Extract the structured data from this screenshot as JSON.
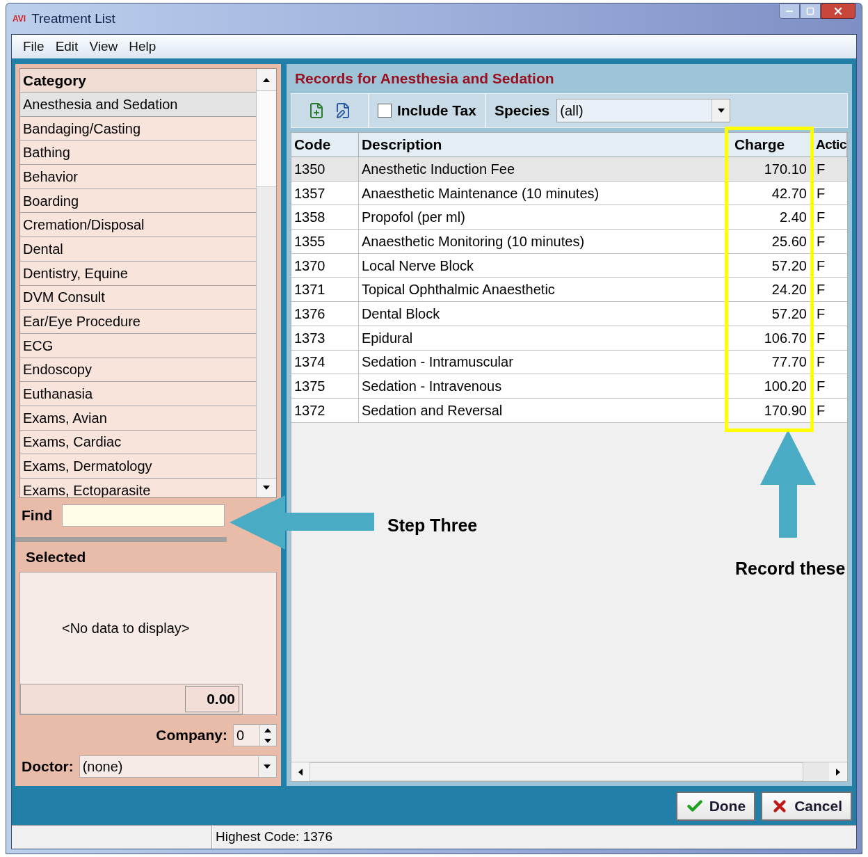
{
  "window": {
    "logo": "AVI",
    "title": "Treatment List"
  },
  "menu": [
    "File",
    "Edit",
    "View",
    "Help"
  ],
  "category_list": {
    "header": "Category",
    "items": [
      {
        "label": "Anesthesia and Sedation",
        "selected": true
      },
      {
        "label": "Bandaging/Casting",
        "selected": false
      },
      {
        "label": "Bathing",
        "selected": false
      },
      {
        "label": "Behavior",
        "selected": false
      },
      {
        "label": "Boarding",
        "selected": false
      },
      {
        "label": "Cremation/Disposal",
        "selected": false
      },
      {
        "label": "Dental",
        "selected": false
      },
      {
        "label": "Dentistry, Equine",
        "selected": false
      },
      {
        "label": "DVM Consult",
        "selected": false
      },
      {
        "label": "Ear/Eye Procedure",
        "selected": false
      },
      {
        "label": "ECG",
        "selected": false
      },
      {
        "label": "Endoscopy",
        "selected": false
      },
      {
        "label": "Euthanasia",
        "selected": false
      },
      {
        "label": "Exams, Avian",
        "selected": false
      },
      {
        "label": "Exams, Cardiac",
        "selected": false
      },
      {
        "label": "Exams, Dermatology",
        "selected": false
      },
      {
        "label": "Exams, Ectoparasite",
        "selected": false
      }
    ]
  },
  "find": {
    "label": "Find"
  },
  "selected_panel": {
    "title": "Selected",
    "empty_message": "<No data to display>",
    "total": "0.00",
    "company": {
      "label": "Company:",
      "value": "0"
    },
    "doctor": {
      "label": "Doctor:",
      "value": "(none)"
    }
  },
  "records": {
    "title": "Records for Anesthesia and Sedation",
    "include_tax": {
      "label": "Include Tax",
      "checked": false
    },
    "species": {
      "label": "Species",
      "value": "(all)"
    },
    "columns": [
      "Code",
      "Description",
      "Charge",
      "Actic"
    ],
    "rows": [
      {
        "code": "1350",
        "description": "Anesthetic Induction Fee",
        "charge": "170.10",
        "action": "F",
        "selected": true
      },
      {
        "code": "1357",
        "description": "Anaesthetic Maintenance (10 minutes)",
        "charge": "42.70",
        "action": "F",
        "selected": false
      },
      {
        "code": "1358",
        "description": "Propofol (per ml)",
        "charge": "2.40",
        "action": "F",
        "selected": false
      },
      {
        "code": "1355",
        "description": "Anaesthetic Monitoring (10 minutes)",
        "charge": "25.60",
        "action": "F",
        "selected": false
      },
      {
        "code": "1370",
        "description": "Local Nerve Block",
        "charge": "57.20",
        "action": "F",
        "selected": false
      },
      {
        "code": "1371",
        "description": "Topical Ophthalmic Anaesthetic",
        "charge": "24.20",
        "action": "F",
        "selected": false
      },
      {
        "code": "1376",
        "description": "Dental Block",
        "charge": "57.20",
        "action": "F",
        "selected": false
      },
      {
        "code": "1373",
        "description": "Epidural",
        "charge": "106.70",
        "action": "F",
        "selected": false
      },
      {
        "code": "1374",
        "description": "Sedation - Intramuscular",
        "charge": "77.70",
        "action": "F",
        "selected": false
      },
      {
        "code": "1375",
        "description": "Sedation - Intravenous",
        "charge": "100.20",
        "action": "F",
        "selected": false
      },
      {
        "code": "1372",
        "description": "Sedation and Reversal",
        "charge": "170.90",
        "action": "F",
        "selected": false
      }
    ]
  },
  "buttons": [
    {
      "label": "Done",
      "kind": "done"
    },
    {
      "label": "Cancel",
      "kind": "cancel"
    }
  ],
  "status_bar": {
    "text": "Highest Code: 1376"
  },
  "annotations": [
    {
      "kind": "arrow-left",
      "label": "Step Three"
    },
    {
      "kind": "arrow-up",
      "label": "Record these"
    },
    {
      "kind": "highlight-box"
    }
  ]
}
